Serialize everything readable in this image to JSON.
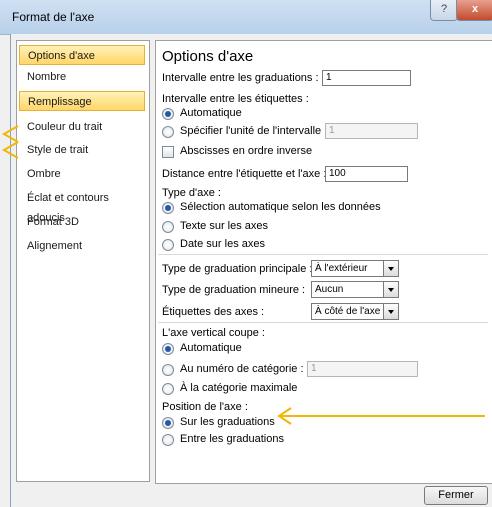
{
  "window": {
    "title": "Format de l'axe",
    "help": "?",
    "close": "x"
  },
  "sidebar": {
    "items": [
      {
        "label": "Options d'axe"
      },
      {
        "label": "Nombre"
      },
      {
        "label": "Remplissage"
      },
      {
        "label": "Couleur du trait"
      },
      {
        "label": "Style de trait"
      },
      {
        "label": "Ombre"
      },
      {
        "label": "Éclat et contours adoucis"
      },
      {
        "label": "Format 3D"
      },
      {
        "label": "Alignement"
      }
    ]
  },
  "panel": {
    "title": "Options d'axe",
    "tick_interval": {
      "label": "Intervalle entre les graduations :",
      "value": "1"
    },
    "label_interval": {
      "label": "Intervalle entre les étiquettes :",
      "auto": "Automatique",
      "specify": "Spécifier l'unité de l'intervalle :",
      "specify_value": "1"
    },
    "reverse": "Abscisses en ordre inverse",
    "distance": {
      "label": "Distance entre l'étiquette et l'axe :",
      "value": "100"
    },
    "axis_type": {
      "label": "Type d'axe :",
      "opt1": "Sélection automatique selon les données",
      "opt2": "Texte sur les axes",
      "opt3": "Date sur les axes"
    },
    "major_tick": {
      "label": "Type de graduation principale :",
      "value": "À l'extérieur"
    },
    "minor_tick": {
      "label": "Type de graduation mineure :",
      "value": "Aucun"
    },
    "axis_labels": {
      "label": "Étiquettes des axes :",
      "value": "À côté de l'axe"
    },
    "vertical_cross": {
      "label": "L'axe vertical coupe :",
      "auto": "Automatique",
      "at_category": "Au numéro de catégorie :",
      "at_category_value": "1",
      "at_max": "À la catégorie maximale"
    },
    "position": {
      "label": "Position de l'axe :",
      "on_ticks": "Sur les graduations",
      "between_ticks": "Entre les graduations"
    }
  },
  "footer": {
    "close_label": "Fermer"
  },
  "colors": {
    "arrow": "#f2b705",
    "selected_bg": "#ffd668",
    "radio_dot": "#2458a6"
  }
}
